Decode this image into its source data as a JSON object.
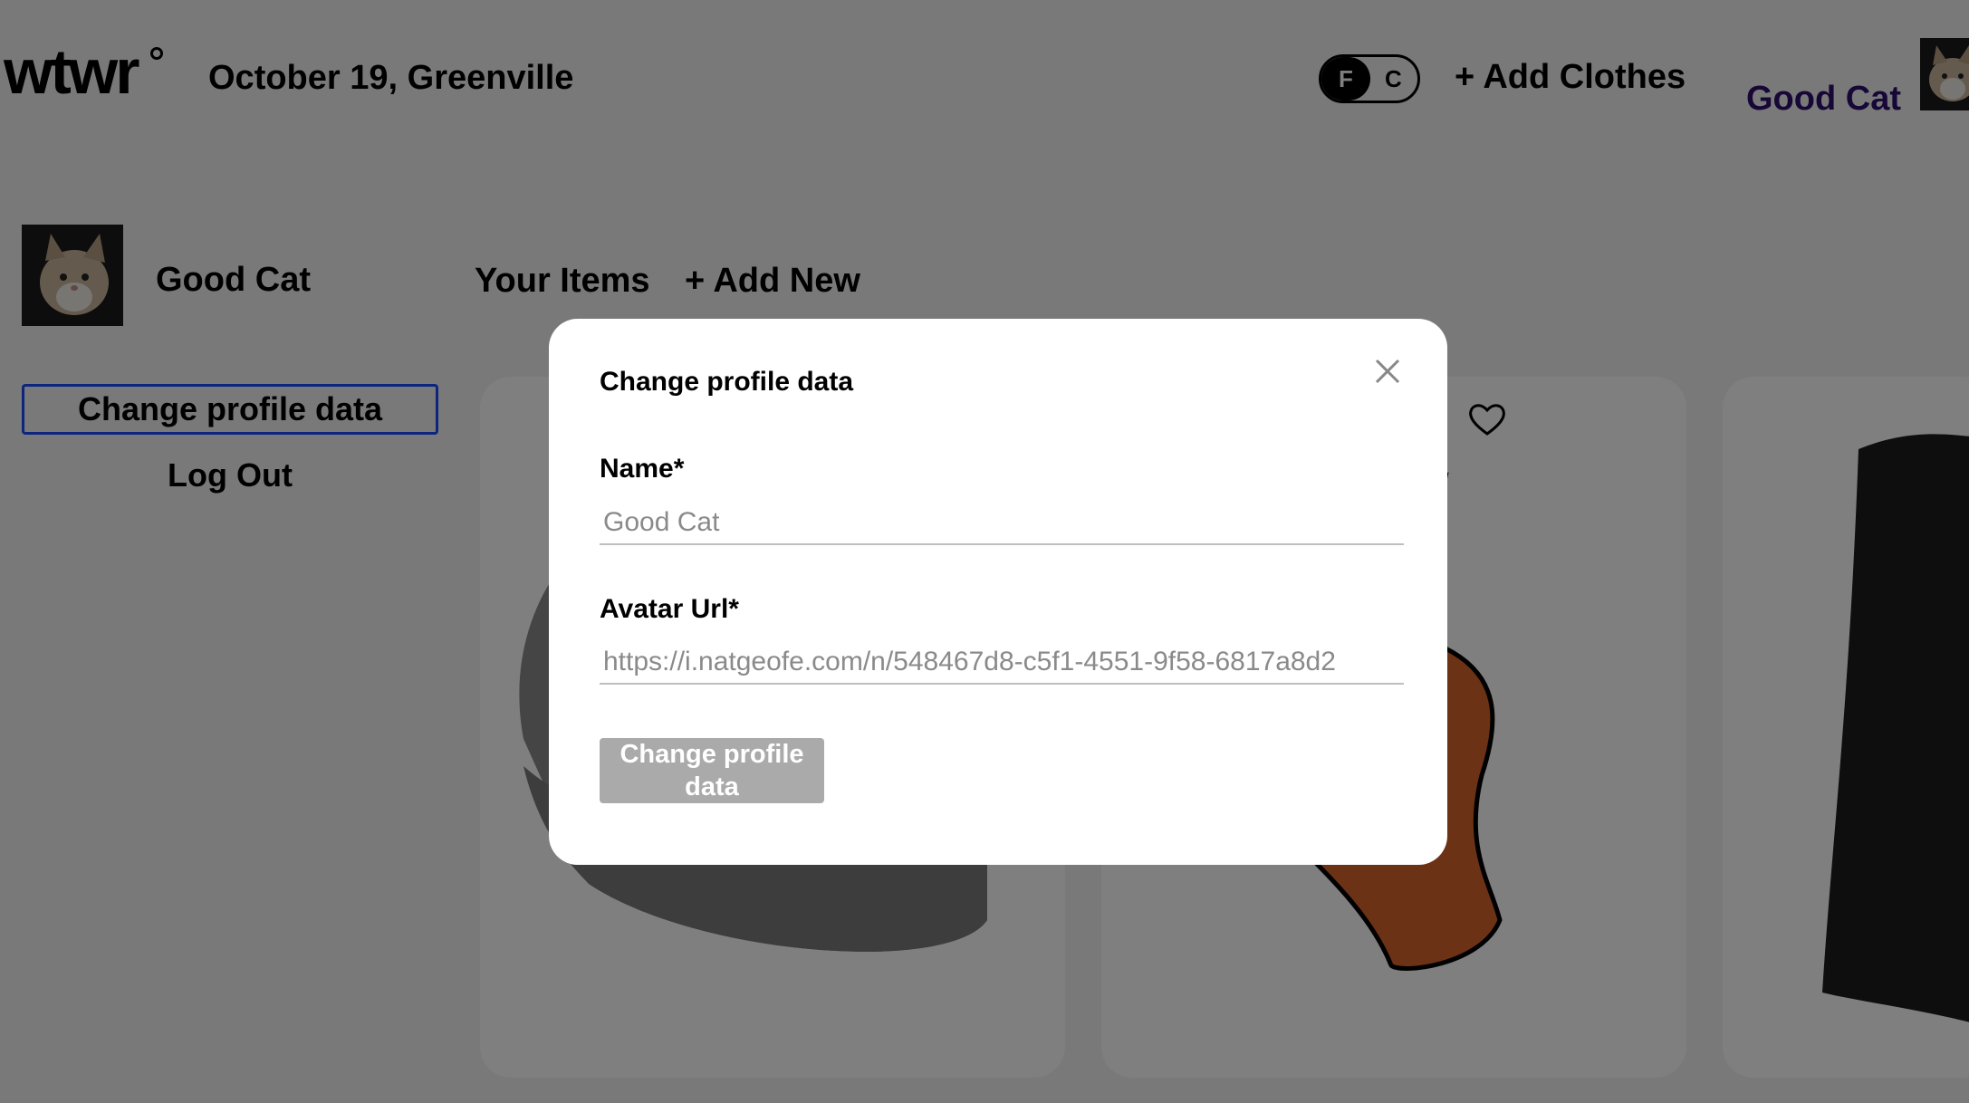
{
  "header": {
    "logo": "wtwr",
    "date_location": "October 19, Greenville",
    "toggle": {
      "left": "F",
      "right": "C",
      "active": "F"
    },
    "add_clothes": "+ Add Clothes",
    "user_name": "Good Cat",
    "user_name_color": "#2f0e6e"
  },
  "sidebar": {
    "user_name": "Good Cat",
    "change_profile_label": "Change profile data",
    "logout_label": "Log Out",
    "active_border_color": "#1b4bff"
  },
  "items_section": {
    "title": "Your Items",
    "add_new": "+ Add New",
    "cards": [
      {
        "item": "beanie",
        "icon": "beanie-image"
      },
      {
        "item": "swimsuit",
        "icon": "swimsuit-image",
        "liked": false
      },
      {
        "item": "vest",
        "icon": "vest-image"
      }
    ]
  },
  "modal": {
    "title": "Change profile data",
    "name_label": "Name*",
    "name_value": "Good Cat",
    "avatar_label": "Avatar Url*",
    "avatar_value": "https://i.natgeofe.com/n/548467d8-c5f1-4551-9f58-6817a8d2",
    "submit_label": "Change profile data"
  },
  "icons": {
    "close": "close-icon",
    "heart": "heart-icon"
  }
}
